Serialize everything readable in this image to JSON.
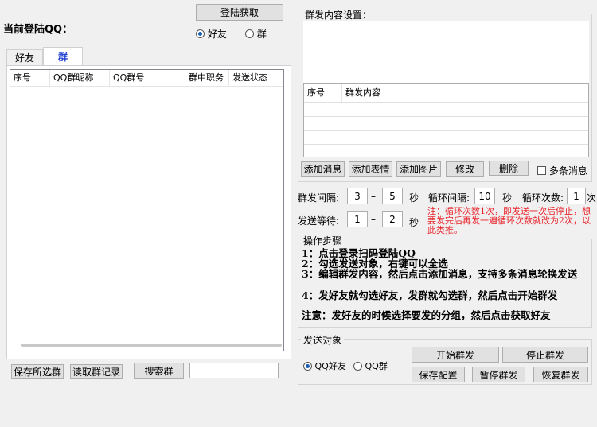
{
  "header": {
    "current_login_label": "当前登陆QQ：",
    "login_fetch_button": "登陆获取",
    "radio_friend": "好友",
    "radio_group": "群"
  },
  "tabs": [
    {
      "label": "好友"
    },
    {
      "label": "群"
    }
  ],
  "group_table": {
    "columns": [
      "序号",
      "QQ群昵称",
      "QQ群号",
      "群中职务",
      "发送状态"
    ]
  },
  "left_bottom": {
    "save_selected": "保存所选群",
    "read_record": "读取群记录",
    "search_group": "搜索群",
    "search_value": ""
  },
  "content_settings": {
    "legend": "群发内容设置：",
    "columns": [
      "序号",
      "群发内容"
    ],
    "buttons": {
      "add_message": "添加消息",
      "add_emoji": "添加表情",
      "add_image": "添加图片",
      "edit": "修改",
      "delete": "删除",
      "multi_message": "多条消息"
    }
  },
  "interval": {
    "send_interval_label": "群发间隔:",
    "send_from": "3",
    "send_to": "5",
    "dash": "–",
    "sec": "秒",
    "loop_interval_label": "循环间隔:",
    "loop_value": "10",
    "loop_count_label": "循环次数:",
    "loop_count_value": "1",
    "count_unit": "次",
    "wait_label": "发送等待:",
    "wait_from": "1",
    "wait_to": "2",
    "note": "注：循环次数1次，即发送一次后停止，想要发完后再发一遍循环次数就改为2次，以此类推。"
  },
  "steps": {
    "legend": "操作步骤",
    "step1": "1：点击登录扫码登陆QQ",
    "step2": "2：勾选发送对象，右键可以全选",
    "step3": "3：编辑群发内容，然后点击添加消息，支持多条消息轮换发送",
    "step4": "4：发好友就勾选好友，发群就勾选群，然后点击开始群发",
    "notice": "注意：发好友的时候选择要发的分组，然后点击获取好友"
  },
  "send_target": {
    "legend": "发送对象",
    "qq_friend": "QQ好友",
    "qq_group": "QQ群",
    "start": "开始群发",
    "stop": "停止群发",
    "save_config": "保存配置",
    "pause": "暂停群发",
    "resume": "恢复群发"
  },
  "colors": {
    "note_red": "#e8242c",
    "tab_active_text": "#1e3fd0",
    "radio_dot": "#1a5fb4"
  }
}
